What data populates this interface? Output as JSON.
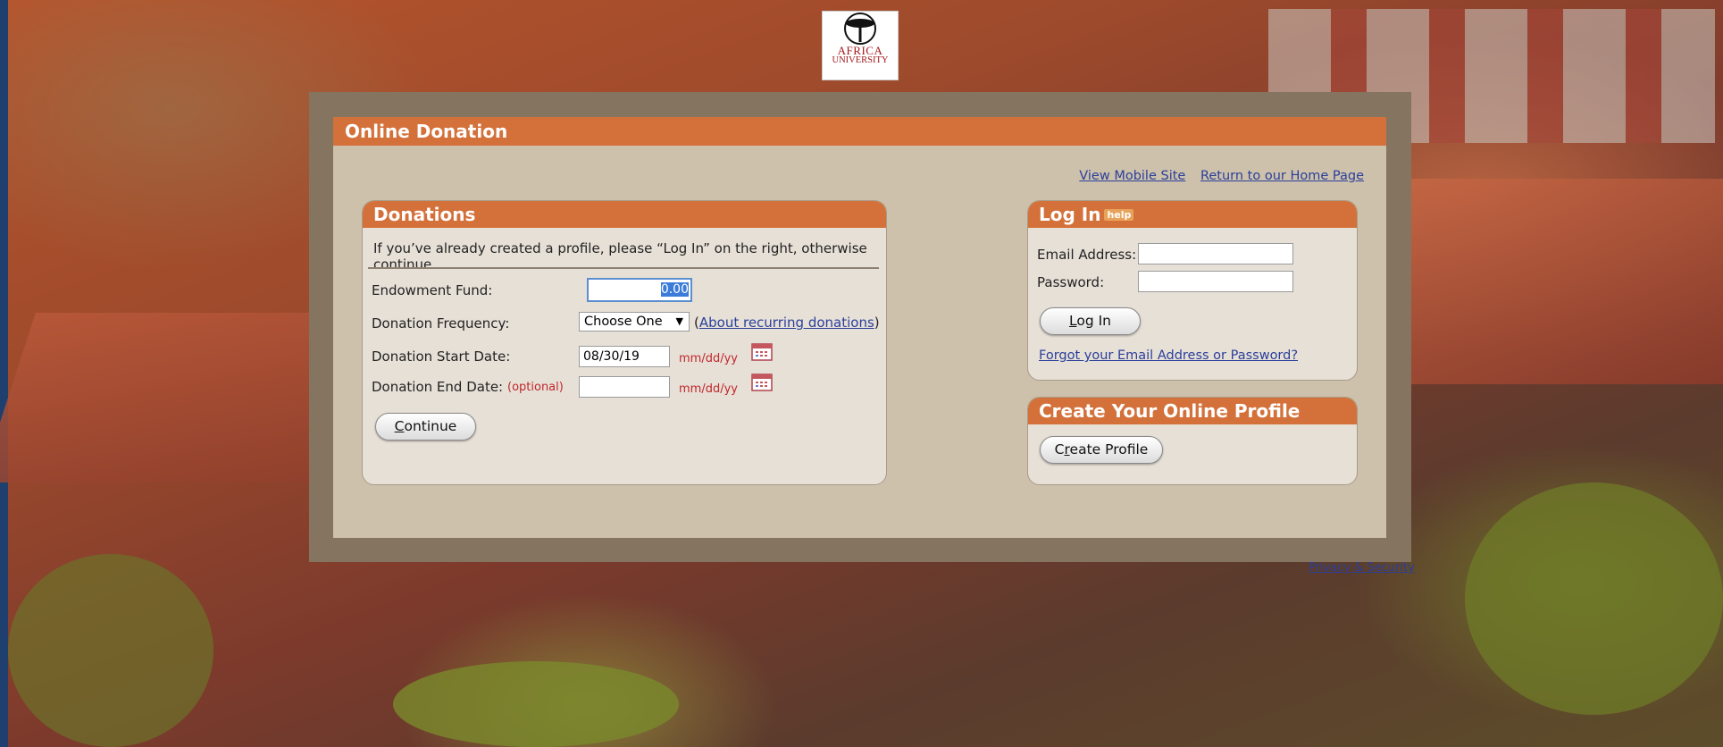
{
  "logo": {
    "line1": "AFRICA",
    "line2": "UNIVERSITY"
  },
  "panel": {
    "title": "Online Donation"
  },
  "toplinks": {
    "mobile": "View Mobile Site",
    "home": "Return to our Home Page"
  },
  "donations": {
    "title": "Donations",
    "intro": "If you’ve already created a profile, please “Log In” on the right, otherwise continue.",
    "fund_label": "Endowment Fund:",
    "fund_value": "0.00",
    "frequency_label": "Donation Frequency:",
    "frequency_value": "Choose One",
    "recurring_open": "(",
    "recurring_link": "About recurring donations",
    "recurring_close": ")",
    "start_label": "Donation Start Date:",
    "start_value": "08/30/19",
    "end_label": "Donation End Date:",
    "end_optional": "(optional)",
    "end_value": "",
    "date_format": "mm/dd/yy",
    "continue_first": "C",
    "continue_rest": "ontinue"
  },
  "login": {
    "title": "Log In",
    "help": "help",
    "email_label": "Email Address:",
    "password_label": "Password:",
    "button_first": "L",
    "button_rest": "og In",
    "forgot": "Forgot your Email Address or Password?"
  },
  "create": {
    "title": "Create Your Online Profile",
    "button_pre": "C",
    "button_u": "r",
    "button_rest": "eate Profile"
  },
  "footer": {
    "privacy": "Privacy & Security"
  },
  "colors": {
    "accent": "#d4713a",
    "frame": "#857560",
    "panel": "#cdc1ac",
    "link": "#2a3f9a",
    "required": "#c1272d"
  }
}
